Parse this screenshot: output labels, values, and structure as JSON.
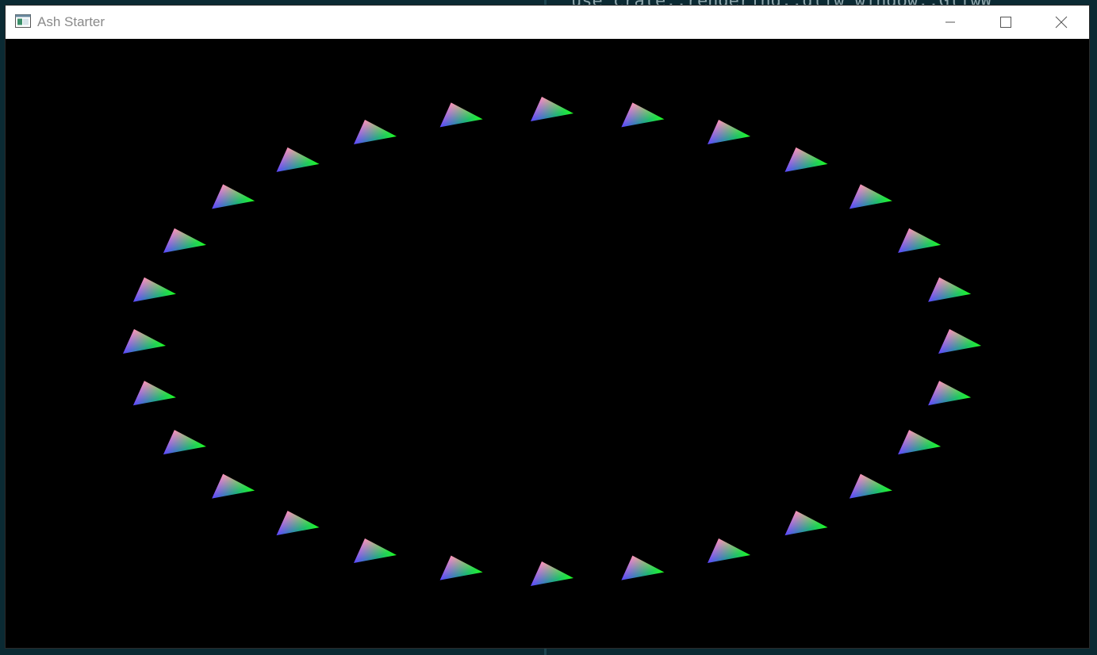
{
  "window": {
    "title": "Ash Starter",
    "controls": {
      "minimize": "minimize-icon",
      "maximize": "maximize-icon",
      "close": "close-icon"
    }
  },
  "scene": {
    "shape": "triangle",
    "count": 28,
    "arrangement": "ellipse",
    "vertex_colors": [
      "#ff2020",
      "#20ff20",
      "#2040ff"
    ],
    "background": "#000000"
  },
  "background_text": {
    "top_line": "use crate::rendering::glfw_window::GlfwW"
  }
}
